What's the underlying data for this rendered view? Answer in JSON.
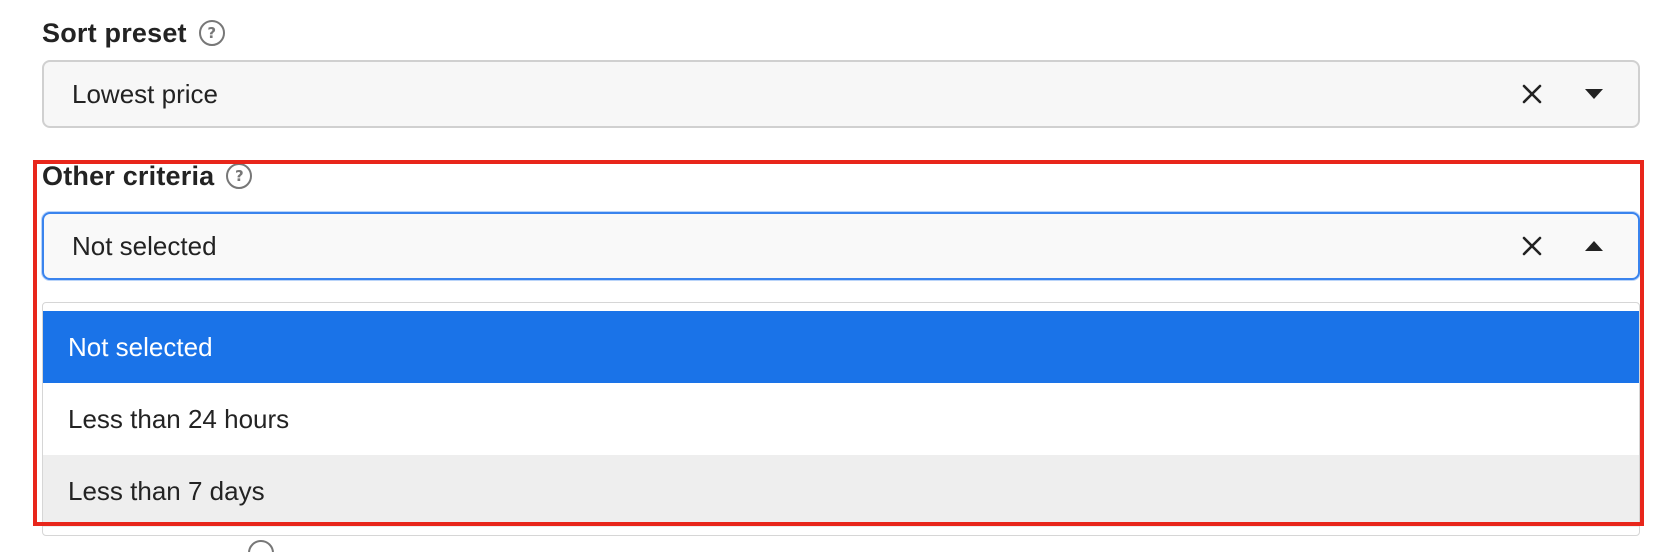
{
  "sort_preset": {
    "label": "Sort preset",
    "help_icon": "question-circle-icon",
    "value": "Lowest price",
    "clear_icon": "close-icon",
    "toggle_icon": "caret-down-icon"
  },
  "other_criteria": {
    "label": "Other criteria",
    "help_icon": "question-circle-icon",
    "value": "Not selected",
    "clear_icon": "close-icon",
    "toggle_icon": "caret-up-icon",
    "expanded": true,
    "options": [
      {
        "label": "Not selected",
        "state": "selected"
      },
      {
        "label": "Less than 24 hours",
        "state": "normal"
      },
      {
        "label": "Less than 7 days",
        "state": "hovered"
      }
    ]
  },
  "colors": {
    "selected_option_bg": "#1a73e8",
    "focus_border": "#3a84ee",
    "highlight_frame": "#e8261b",
    "hover_option_bg": "#eeeeee"
  }
}
